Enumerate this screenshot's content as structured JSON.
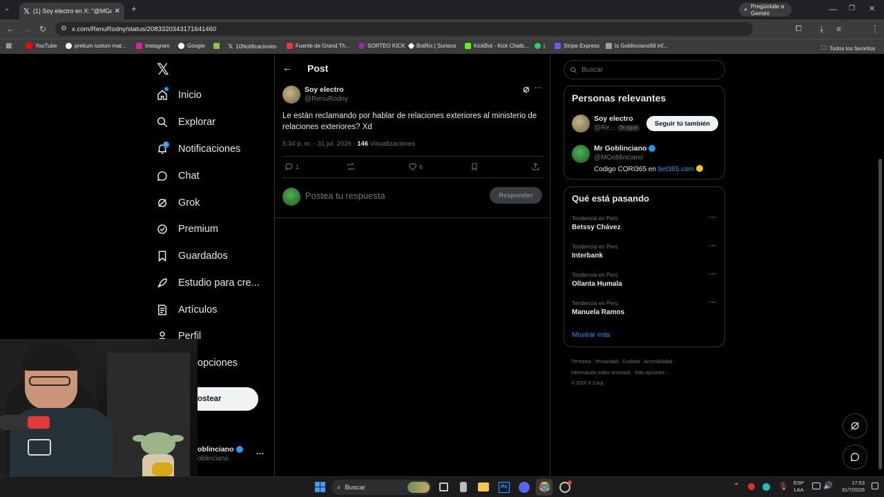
{
  "browser": {
    "tab_title": "(1) Soy electro en X: \"@MGobli...",
    "url": "x.com/RenuRodny/status/2083320343171641460",
    "gemini_label": "Pregúntale a Gemini",
    "bookmarks": [
      "YouTube",
      "pretium iustum mat...",
      "Instagram",
      "Google",
      "",
      "10Notificaciones",
      "Fuente de Grand Th...",
      "SORTEO KICK",
      "BotRix | Sorteos",
      "KickBot - Kick Chatb...",
      "",
      "Stripe Express",
      "Is Goblinciano69 inf..."
    ],
    "all_bookmarks": "Todos los favoritos"
  },
  "nav": {
    "items": [
      "Inicio",
      "Explorar",
      "Notificaciones",
      "Chat",
      "Grok",
      "Premium",
      "Guardados",
      "Estudio para cre...",
      "Artículos",
      "Perfil",
      "opciones"
    ],
    "notif_badge": "1",
    "post_button": "ostear",
    "account_name": "oblinciano",
    "account_handle": "oblinciano"
  },
  "post": {
    "header": "Post",
    "author_name": "Soy electro",
    "author_handle": "@RenuRodny",
    "text": "Le están reclamando por hablar de relaciones exteriores al ministerio de relaciones exteriores? Xd",
    "time": "5:34 p. m. · 31 jul. 2026 · ",
    "views_count": "146",
    "views_label": " Visualizaciones",
    "replies": "1",
    "likes": "6",
    "reply_placeholder": "Postea tu respuesta",
    "reply_button": "Responder"
  },
  "right": {
    "search_placeholder": "Buscar",
    "relevant_title": "Personas relevantes",
    "p1_name": "Soy electro",
    "p1_handle": "@Re...",
    "p1_follows": "Te sigue",
    "p1_button": "Seguir tú también",
    "p2_name": "Mr Goblinciano",
    "p2_handle": "@MGoblinciano",
    "p2_bio": "Codigo CORI365 en ",
    "p2_link": "bet365.com",
    "trending_title": "Qué está pasando",
    "trends": [
      {
        "meta": "Tendencia en Perú",
        "name": "Betssy Chávez"
      },
      {
        "meta": "Tendencia en Perú",
        "name": "Interbank"
      },
      {
        "meta": "Tendencia en Perú",
        "name": "Ollanta Humala"
      },
      {
        "meta": "Tendencia en Perú",
        "name": "Manuela Ramos"
      }
    ],
    "show_more": "Mostrar más",
    "footer_line1": "Términos · Privacidad · Cookies · Accesibilidad ·",
    "footer_line2": "Información sobre anuncios · Más opciones ···",
    "footer_line3": "© 2026 X Corp."
  },
  "taskbar": {
    "search": "Buscar",
    "lang1": "ESP",
    "lang2": "LAA",
    "time": "17:53",
    "date": "31/7/2026"
  },
  "colors": {
    "accent": "#1d9bf0",
    "bg": "#000000",
    "border": "#2f3336"
  }
}
